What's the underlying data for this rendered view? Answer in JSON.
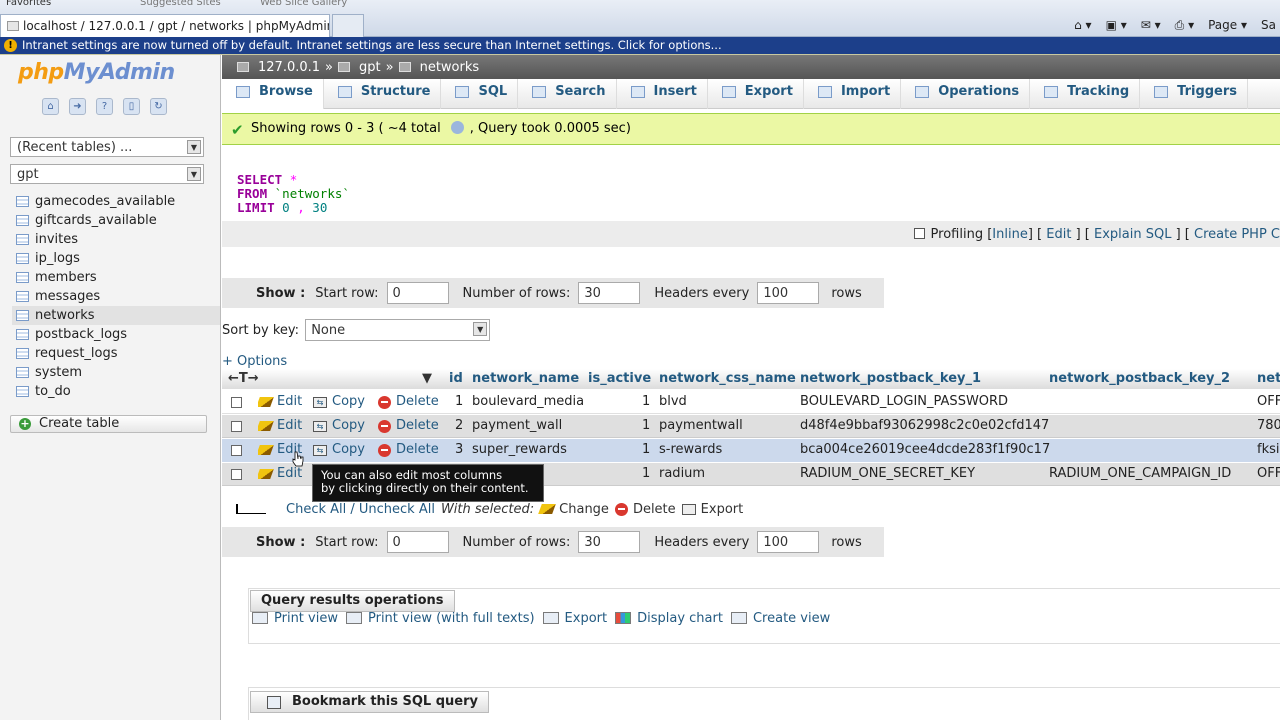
{
  "browser": {
    "favorites_label": "Favorites",
    "suggested_sites": "Suggested Sites",
    "web_slice_gallery": "Web Slice Gallery",
    "tab_title": "localhost / 127.0.0.1 / gpt / networks | phpMyAdmin ...",
    "page_menu": "Page",
    "safety_menu": "Sa",
    "infobar_text": "Intranet settings are now turned off by default. Intranet settings are less secure than Internet settings. Click for options..."
  },
  "sidebar": {
    "logo_php": "php",
    "logo_myadmin": "MyAdmin",
    "recent_tables": "(Recent tables) ...",
    "database": "gpt",
    "tables": [
      "gamecodes_available",
      "giftcards_available",
      "invites",
      "ip_logs",
      "members",
      "messages",
      "networks",
      "postback_logs",
      "request_logs",
      "system",
      "to_do"
    ],
    "active_table": "networks",
    "create_table": "Create table"
  },
  "breadcrumb": {
    "server": "127.0.0.1",
    "db": "gpt",
    "table": "networks",
    "sep": "»"
  },
  "tabs": [
    "Browse",
    "Structure",
    "SQL",
    "Search",
    "Insert",
    "Export",
    "Import",
    "Operations",
    "Tracking",
    "Triggers"
  ],
  "success": {
    "message": "Showing rows 0 - 3 ( ~4 total",
    "query_time": ", Query took 0.0005 sec)"
  },
  "sql": {
    "select": "SELECT",
    "star": "*",
    "from": "FROM",
    "table": "`networks`",
    "limit": "LIMIT",
    "offset": "0",
    "comma": ",",
    "count": "30"
  },
  "profiling": {
    "label": "Profiling",
    "inline": "Inline",
    "edit": "Edit",
    "explain": "Explain SQL",
    "create_php": "Create PHP C"
  },
  "navigation": {
    "show": "Show :",
    "start_row_label": "Start row:",
    "start_row": "0",
    "num_rows_label": "Number of rows:",
    "num_rows": "30",
    "headers_label": "Headers every",
    "headers": "100",
    "rows_suffix": "rows"
  },
  "sort": {
    "label": "Sort by key:",
    "value": "None"
  },
  "options_link": "+ Options",
  "columns": [
    "id",
    "network_name",
    "is_active",
    "network_css_name",
    "network_postback_key_1",
    "network_postback_key_2",
    "net"
  ],
  "row_actions": {
    "edit": "Edit",
    "copy": "Copy",
    "delete": "Delete"
  },
  "rows": [
    {
      "id": "1",
      "network_name": "boulevard_media",
      "is_active": "1",
      "css": "blvd",
      "key1": "BOULEVARD_LOGIN_PASSWORD",
      "key2": "",
      "net": "OFF"
    },
    {
      "id": "2",
      "network_name": "payment_wall",
      "is_active": "1",
      "css": "paymentwall",
      "key1": "d48f4e9bbaf93062998c2c0e02cfd147",
      "key2": "",
      "net": "780"
    },
    {
      "id": "3",
      "network_name": "super_rewards",
      "is_active": "1",
      "css": "s-rewards",
      "key1": "bca004ce26019cee4dcde283f1f90c17",
      "key2": "",
      "net": "fksi"
    },
    {
      "id": "",
      "network_name": "",
      "is_active": "1",
      "css": "radium",
      "key1": "RADIUM_ONE_SECRET_KEY",
      "key2": "RADIUM_ONE_CAMPAIGN_ID",
      "net": "OFF"
    }
  ],
  "tooltip": {
    "line1": "You can also edit most columns",
    "line2": "by clicking directly on their content."
  },
  "bulk": {
    "check_all": "Check All / Uncheck All",
    "with_selected": "With selected:",
    "change": "Change",
    "delete": "Delete",
    "export": "Export"
  },
  "query_ops": {
    "title": "Query results operations",
    "print_view": "Print view",
    "print_view_full": "Print view (with full texts)",
    "export": "Export",
    "display_chart": "Display chart",
    "create_view": "Create view"
  },
  "bookmark": {
    "title": "Bookmark this SQL query"
  }
}
